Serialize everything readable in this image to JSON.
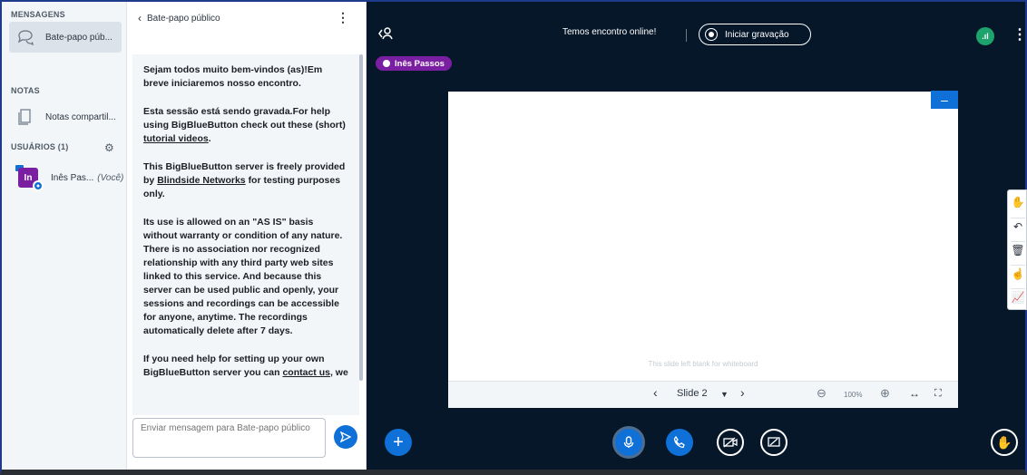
{
  "sidebar": {
    "messages_title": "MENSAGENS",
    "chat_item_label": "Bate-papo púb...",
    "notes_title": "NOTAS",
    "notes_item_label": "Notas compartil...",
    "users_title": "USUÁRIOS (1)",
    "user_initials": "In",
    "user_name": "Inês Pas...",
    "user_you": "(Você)"
  },
  "chat": {
    "title": "Bate-papo público",
    "messages": [
      "Sejam todos muito bem-vindos (as)!Em breve iniciaremos nosso encontro.",
      "Esta sessão está sendo gravada.For help using BigBlueButton check out these (short)",
      "tutorial videos",
      "This BigBlueButton server is freely provided by",
      "Blindside Networks",
      "for testing purposes only.",
      "Its use is allowed on an \"AS IS\" basis without warranty or condition of any nature. There is no association nor recognized relationship with any third party web sites linked to this service. And because this server can be used public and openly, your sessions and recordings can be accessible for anyone, anytime. The recordings automatically delete after 7 days.",
      "If you need help for setting up your own BigBlueButton server you can",
      "contact us",
      ", we"
    ],
    "input_placeholder": "Enviar mensagem para Bate-papo público"
  },
  "main": {
    "meeting_title": "Temos encontro online!",
    "record_label": "Iniciar gravação",
    "talker_name": "Inês Passos",
    "slide_caption": "This slide left blank for whiteboard",
    "slide_label": "Slide 2",
    "zoom_label": "100%"
  },
  "colors": {
    "accent": "#0f70d7",
    "background": "#06172a",
    "avatar": "#7b1fa2",
    "connection": "#1da36b"
  }
}
